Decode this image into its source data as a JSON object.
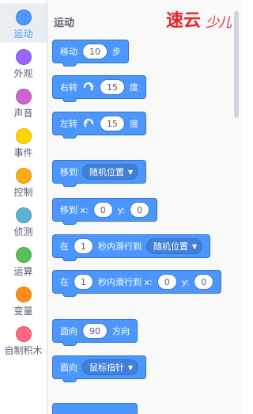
{
  "categories": [
    {
      "label": "运动",
      "color": "#4c97ff",
      "selected": true
    },
    {
      "label": "外观",
      "color": "#9966ff"
    },
    {
      "label": "声音",
      "color": "#cf63cf"
    },
    {
      "label": "事件",
      "color": "#ffd500"
    },
    {
      "label": "控制",
      "color": "#ffab19"
    },
    {
      "label": "侦测",
      "color": "#5cb1d6"
    },
    {
      "label": "运算",
      "color": "#59c059"
    },
    {
      "label": "变量",
      "color": "#ff8c1a"
    },
    {
      "label": "自制积木",
      "color": "#ff6680"
    }
  ],
  "section": {
    "title": "运动"
  },
  "logo": {
    "text": "速云少儿编程"
  },
  "blocks": {
    "move": {
      "label": "移动",
      "value": "10",
      "unit": "步"
    },
    "turn_right": {
      "label": "右转",
      "value": "15",
      "unit": "度"
    },
    "turn_left": {
      "label": "左转",
      "value": "15",
      "unit": "度"
    },
    "goto": {
      "label": "移到",
      "option": "随机位置"
    },
    "goto_xy": {
      "label": "移到 x:",
      "x": "0",
      "y_label": "y:",
      "y": "0"
    },
    "glide_to": {
      "prefix": "在",
      "secs": "1",
      "middle": "秒内滑行到",
      "option": "随机位置"
    },
    "glide_xy": {
      "prefix": "在",
      "secs": "1",
      "middle": "秒内滑行到 x:",
      "x": "0",
      "y_label": "y:",
      "y": "0"
    },
    "point_dir": {
      "label": "面向",
      "value": "90",
      "unit": "方向"
    },
    "point_towards": {
      "label": "面向",
      "option": "鼠标指针"
    }
  },
  "colors": {
    "motion": "#4c97ff",
    "motion_dark": "#3373cc"
  }
}
